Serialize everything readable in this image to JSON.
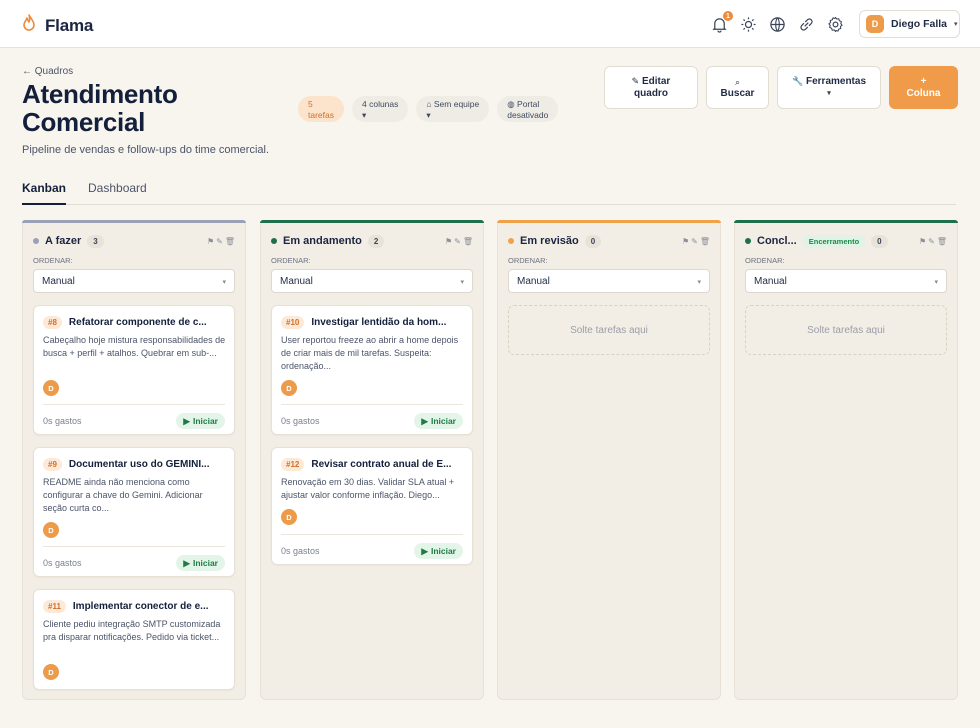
{
  "app": {
    "name": "Flama",
    "brand_color": "#ef8a3a"
  },
  "topbar": {
    "notifications_count": "1",
    "icons": [
      "bell-icon",
      "sun-icon",
      "globe-icon",
      "link-icon",
      "gear-icon"
    ],
    "user": {
      "initial": "D",
      "name": "Diego Falla"
    }
  },
  "header": {
    "back_label": "← Quadros",
    "title": "Atendimento Comercial",
    "description": "Pipeline de vendas e follow-ups do time comercial.",
    "chips": [
      {
        "line1": "5",
        "line2": "tarefas"
      },
      {
        "line1": "4 colunas",
        "line2": "▾"
      },
      {
        "line1": "⌂ Sem equipe",
        "line2": "▾"
      },
      {
        "line1": "◍ Portal",
        "line2": "desativado"
      }
    ],
    "buttons": {
      "edit_icon": "✎",
      "edit_l1": "Editar",
      "edit_l2": "quadro",
      "search_icon": "⌕",
      "search": "Buscar",
      "tools_icon": "🔧",
      "tools": "Ferramentas",
      "tools_caret": "▾",
      "add_col_icon": "+",
      "add_col": "Coluna"
    }
  },
  "tabs": [
    {
      "label": "Kanban"
    },
    {
      "label": "Dashboard"
    }
  ],
  "columns": [
    {
      "name": "A fazer",
      "count": "3",
      "color": "#9aa0b8",
      "tag": "",
      "sort_label": "ORDENAR:",
      "sort_value": "Manual",
      "cards": [
        {
          "id": "#8",
          "title": "Refatorar componente de c...",
          "desc": "Cabeçalho hoje mistura responsabilidades de busca + perfil + atalhos. Quebrar em sub-...",
          "avatar": "D",
          "time": "0s gastos",
          "action": "Iniciar"
        },
        {
          "id": "#9",
          "title": "Documentar uso do GEMINI...",
          "desc": "README ainda não menciona como configurar a chave do Gemini. Adicionar seção curta co...",
          "avatar": "D",
          "time": "0s gastos",
          "action": "Iniciar"
        },
        {
          "id": "#11",
          "title": "Implementar conector de e...",
          "desc": "Cliente pediu integração SMTP customizada pra disparar notificações. Pedido via ticket...",
          "avatar": "D",
          "time": "",
          "action": ""
        }
      ]
    },
    {
      "name": "Em andamento",
      "count": "2",
      "color": "#1f6f4a",
      "tag": "",
      "sort_label": "ORDENAR:",
      "sort_value": "Manual",
      "cards": [
        {
          "id": "#10",
          "title": "Investigar lentidão da hom...",
          "desc": "User reportou freeze ao abrir a home depois de criar mais de mil tarefas. Suspeita: ordenação...",
          "avatar": "D",
          "time": "0s gastos",
          "action": "Iniciar"
        },
        {
          "id": "#12",
          "title": "Revisar contrato anual de E...",
          "desc": "Renovação em 30 dias. Validar SLA atual + ajustar valor conforme inflação. Diego...",
          "avatar": "D",
          "time": "0s gastos",
          "action": "Iniciar"
        }
      ]
    },
    {
      "name": "Em revisão",
      "count": "0",
      "color": "#f0a24a",
      "tag": "",
      "sort_label": "ORDENAR:",
      "sort_value": "Manual",
      "dropzone": "Solte tarefas aqui",
      "cards": []
    },
    {
      "name": "Concl...",
      "count": "0",
      "color": "#1f6f4a",
      "tag": "Encerramento",
      "sort_label": "ORDENAR:",
      "sort_value": "Manual",
      "dropzone": "Solte tarefas aqui",
      "cards": []
    }
  ]
}
